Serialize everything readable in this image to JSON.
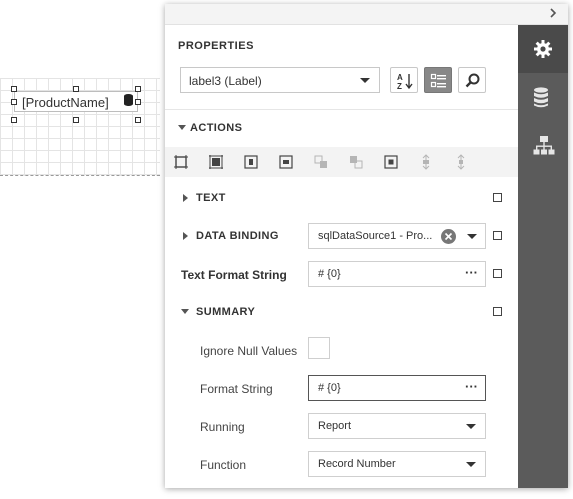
{
  "design_surface": {
    "label_text": "[ProductName]",
    "icons": {
      "database_glyph": "database-icon"
    }
  },
  "panel": {
    "title": "PROPERTIES",
    "component_combo": {
      "value": "label3 (Label)"
    },
    "tabs": [
      {
        "name": "properties",
        "icon": "gear-icon",
        "active": true
      },
      {
        "name": "field-list",
        "icon": "database-icon",
        "active": false
      },
      {
        "name": "report-explorer",
        "icon": "hierarchy-icon",
        "active": false
      }
    ],
    "sections": {
      "actions": {
        "label": "ACTIONS",
        "expanded": true
      },
      "text": {
        "label": "TEXT",
        "expanded": false
      },
      "data_binding": {
        "label": "DATA BINDING",
        "expanded": false,
        "value": "sqlDataSource1 - Pro..."
      },
      "text_format_string": {
        "label": "Text Format String",
        "value": "# {0}"
      },
      "summary": {
        "label": "SUMMARY",
        "expanded": true
      }
    },
    "summary_props": {
      "ignore_null_values": {
        "label": "Ignore Null Values",
        "checked": false
      },
      "format_string": {
        "label": "Format String",
        "value": "# {0}"
      },
      "running": {
        "label": "Running",
        "value": "Report"
      },
      "function": {
        "label": "Function",
        "value": "Record Number"
      }
    },
    "action_icons": [
      "align-to-grid-icon",
      "size-to-grid-icon",
      "center-horizontally-icon",
      "center-vertically-icon",
      "bring-to-front-icon",
      "send-to-back-icon",
      "fit-bounds-icon",
      "vertical-anchor-icon",
      "horizontal-anchor-icon"
    ]
  },
  "colors": {
    "sidebar_bg": "#5b5b5b",
    "sidebar_active": "#4a4a4a",
    "accent_button": "#888888"
  }
}
